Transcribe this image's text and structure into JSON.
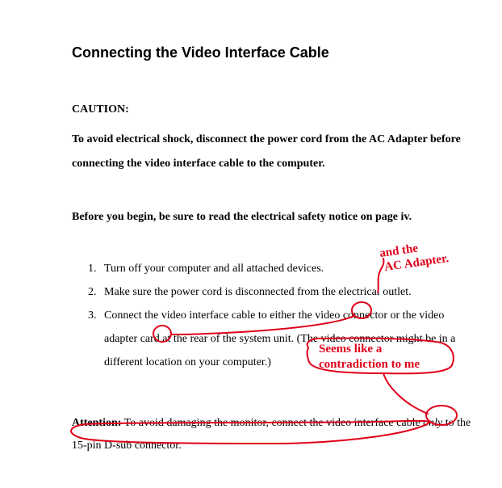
{
  "title": "Connecting the Video Interface Cable",
  "caution": {
    "label": "CAUTION:",
    "body": "To avoid electrical shock, disconnect the power cord from the AC Adapter before connecting the video interface cable to the computer."
  },
  "before_begin": "Before you begin, be sure to read the electrical safety notice on page iv.",
  "steps": {
    "n1": "1.",
    "t1": "Turn off your computer and all attached devices.",
    "n2": "2.",
    "t2": "Make sure the power cord is disconnected from the electrical outlet.",
    "n3": "3.",
    "t3": "Connect the video interface cable to either the video connector or the video adapter card at the rear of the system unit. (The video connector might be in a different location on your computer.)"
  },
  "attention": {
    "label": "Attention:",
    "body_before_only": " To avoid damaging the monitor, connect the video interface cable ",
    "only_word": "only",
    "body_after_only": " to the 15-pin D-sub connector."
  },
  "annotations": {
    "ac_adapter_line1": "and the",
    "ac_adapter_line2": "AC Adapter.",
    "contradiction_line1": "Seems like a",
    "contradiction_line2": "contradiction to me"
  }
}
